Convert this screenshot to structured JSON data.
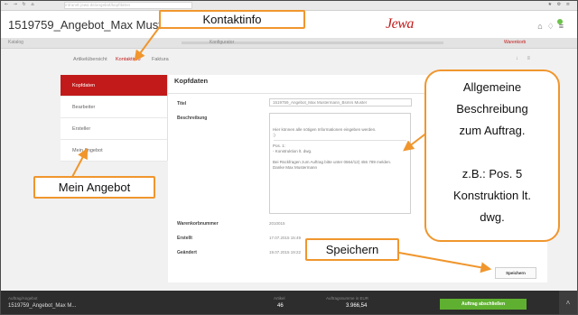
{
  "browser": {
    "nav": "← → ↻ ⌂",
    "url": "intranet.jewa.de/angebot/kopfdaten",
    "right": "★ ⚙ ≡"
  },
  "app": {
    "title": "1519759_Angebot_Max Musterm",
    "logo": "Jewa"
  },
  "stepper": {
    "left": "Katalog",
    "middle": "Konfigurator",
    "right": "Warenkorb"
  },
  "subtabs": {
    "items": [
      "Artikelübersicht",
      "Kontaktinfo",
      "Faktura"
    ],
    "active_index": 1,
    "icons": "↓ ≡"
  },
  "left_nav": {
    "items": [
      "Kopfdaten",
      "Bearbeiter",
      "Ersteller",
      "Mein Angebot"
    ],
    "active_index": 0
  },
  "kopfdaten": {
    "heading": "Kopfdaten",
    "fields": {
      "titel_label": "Titel",
      "titel_value": "1519759_Angebot_Max Mustermann_Bsmrs Muster",
      "beschreibung_label": "Beschreibung",
      "beschreibung_text": "Hier können alle nötigen Informationen eingeben werden.\n:)\n\nPos. 1:\n- Konstruktion lt. dwg.\n\nBei Rückfragen zum Auftrag bitte unter 0664/12) 456 789 melden.\nDanke Max Mustermann",
      "warenkorbnummer_label": "Warenkorbnummer",
      "warenkorbnummer_value": "2010015",
      "erstellt_label": "Erstellt",
      "erstellt_value": "17.07.2015 15:49",
      "geaendert_label": "Geändert",
      "geaendert_value": "19.07.2015 19:22"
    },
    "save_button": "Speichern"
  },
  "footer": {
    "cart_label": "Auftrag/Angebot",
    "cart_value": "1519759_Angebot_Max M...",
    "articles_label": "Artikel",
    "articles_value": "46",
    "sum_label": "Auftragssumme in EUR",
    "sum_value": "3.966,54",
    "submit_button": "Auftrag abschließen",
    "up_icon": "˄"
  },
  "callouts": {
    "kontaktinfo": "Kontaktinfo",
    "mein_angebot": "Mein Angebot",
    "speichern": "Speichern",
    "allgemeine_lines": [
      "Allgemeine",
      "Beschreibung",
      "zum Auftrag.",
      "",
      "z.B.: Pos. 5",
      "Konstruktion lt.",
      "dwg."
    ],
    "color": "#f0962d"
  },
  "colors": {
    "accent_red": "#c21a1a",
    "submit_green": "#5fb030",
    "footer_dark": "#2d2d2d"
  }
}
